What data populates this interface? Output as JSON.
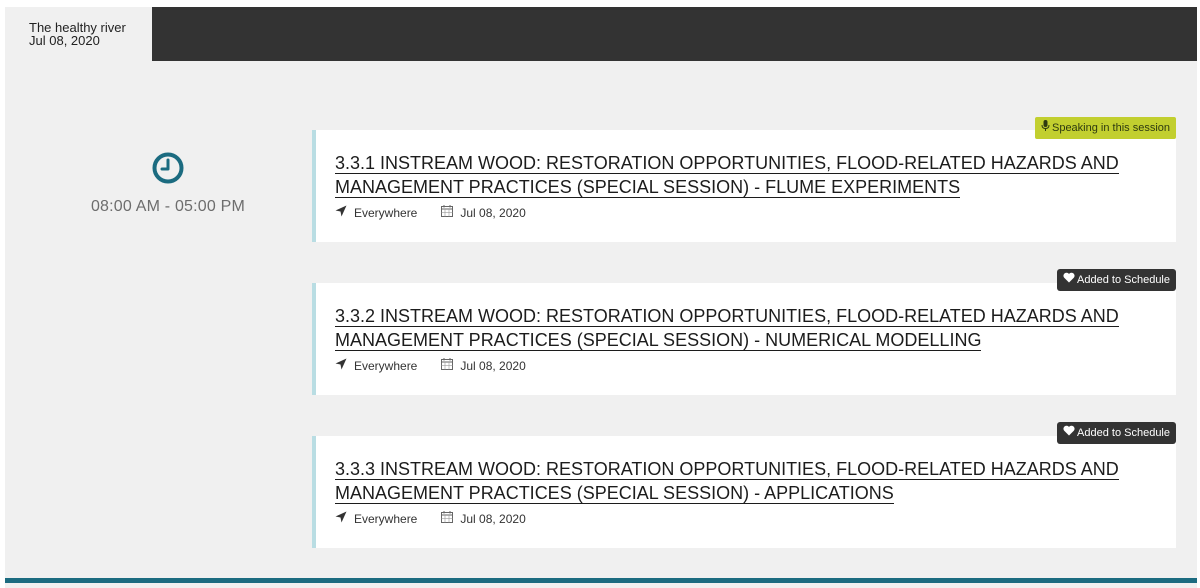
{
  "day_tab": {
    "title": "The healthy river",
    "date": "Jul 08, 2020"
  },
  "time_slot": {
    "range": "08:00 AM - 05:00 PM",
    "icon": "clock-icon"
  },
  "colors": {
    "accent": "#1b6b80",
    "speaking_badge": "#c2cf2f",
    "added_badge": "#333333",
    "card_border": "#b9dde3"
  },
  "sessions": [
    {
      "title_line1": "3.3.1 INSTREAM WOOD: RESTORATION OPPORTUNITIES, FLOOD-RELATED HAZARDS AND",
      "title_line2": "MANAGEMENT PRACTICES (SPECIAL SESSION) - FLUME EXPERIMENTS",
      "location": "Everywhere",
      "date": "Jul 08, 2020",
      "badge": "Speaking in this session",
      "badge_icon": "microphone-icon"
    },
    {
      "title_line1": "3.3.2 INSTREAM WOOD: RESTORATION OPPORTUNITIES, FLOOD-RELATED HAZARDS AND",
      "title_line2": "MANAGEMENT PRACTICES (SPECIAL SESSION) - NUMERICAL MODELLING",
      "location": "Everywhere",
      "date": "Jul 08, 2020",
      "badge": "Added to Schedule",
      "badge_icon": "heart-icon"
    },
    {
      "title_line1": "3.3.3 INSTREAM WOOD: RESTORATION OPPORTUNITIES, FLOOD-RELATED HAZARDS AND",
      "title_line2": "MANAGEMENT PRACTICES (SPECIAL SESSION) - APPLICATIONS",
      "location": "Everywhere",
      "date": "Jul 08, 2020",
      "badge": "Added to Schedule",
      "badge_icon": "heart-icon"
    }
  ]
}
